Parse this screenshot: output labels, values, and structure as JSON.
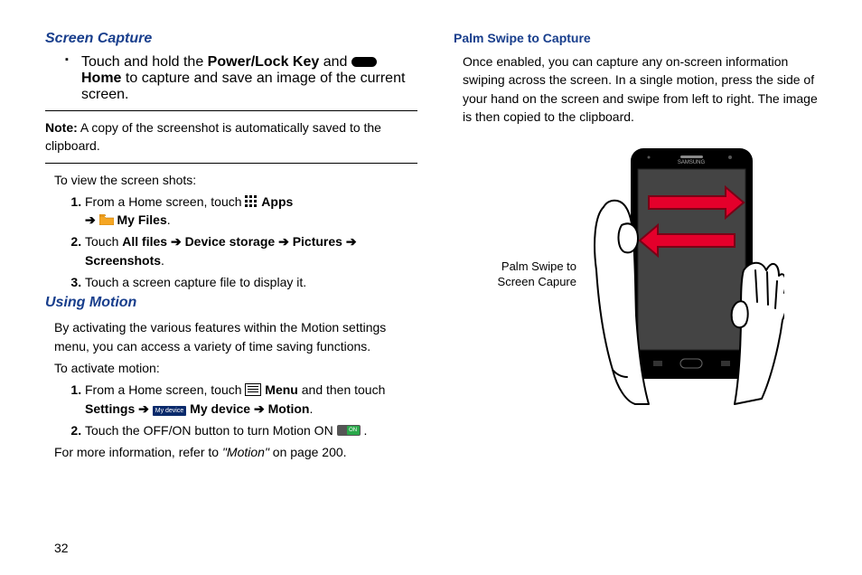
{
  "page_number": "32",
  "left": {
    "h_screen_capture": "Screen Capture",
    "bullet1_pre": "Touch and hold the ",
    "bullet1_key": "Power/Lock Key",
    "bullet1_mid": " and ",
    "bullet1_home": " Home",
    "bullet1_post": " to capture and save an image of the current screen.",
    "note_label": "Note:",
    "note_text": " A copy of the screenshot is automatically saved to the clipboard.",
    "view_intro": "To view the screen shots:",
    "step1_pre": "From a Home screen, touch ",
    "step1_apps": " Apps",
    "step1_arrow_myfiles": " My Files",
    "step2_pre": "Touch ",
    "step2_allfiles": "All files",
    "step2_device": "Device storage",
    "step2_pictures": "Pictures",
    "step2_screenshots": "Screenshots",
    "step3": "Touch a screen capture file to display it.",
    "h_using_motion": "Using Motion",
    "motion_para": "By activating the various features within the Motion settings menu, you can access a variety of time saving functions.",
    "activate_intro": "To activate motion:",
    "mstep1_pre": "From a Home screen, touch ",
    "mstep1_menu": " Menu",
    "mstep1_mid": " and then touch ",
    "mstep1_settings": "Settings",
    "mstep1_mydevice": " My device",
    "mstep1_motion": "Motion",
    "mstep2_pre": "Touch the OFF/ON button to turn Motion ON ",
    "toggle_text": "ON",
    "motion_xref_pre": "For more information, refer to ",
    "motion_xref_link": "\"Motion\"",
    "motion_xref_post": " on page 200."
  },
  "right": {
    "h_palm_swipe": "Palm Swipe to Capture",
    "palm_para": "Once enabled, you can capture any on-screen information swiping across the screen. In a single motion, press the side of your hand on the screen and swipe from left to right. The image is then copied to the clipboard.",
    "diagram_caption_l1": "Palm Swipe to",
    "diagram_caption_l2": "Screen Capure"
  },
  "icons": {
    "mydevice_label": "My device"
  }
}
